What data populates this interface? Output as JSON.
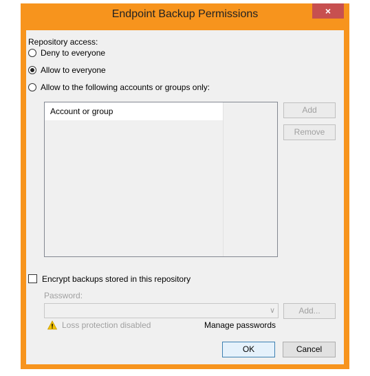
{
  "window": {
    "title": "Endpoint Backup Permissions",
    "close_glyph": "×",
    "frame_color": "#f7941d"
  },
  "access": {
    "label": "Repository access:",
    "options": [
      {
        "label": "Deny to everyone",
        "checked": false
      },
      {
        "label": "Allow to everyone",
        "checked": true
      },
      {
        "label": "Allow to the following accounts or groups only:",
        "checked": false
      }
    ]
  },
  "accounts": {
    "column_header": "Account or group",
    "rows": []
  },
  "buttons": {
    "add": "Add",
    "remove": "Remove",
    "add_password": "Add...",
    "ok": "OK",
    "cancel": "Cancel"
  },
  "encryption": {
    "checkbox_label": "Encrypt backups stored in this repository",
    "checked": false,
    "password_label": "Password:",
    "password_value": "",
    "warning_icon": "warning-icon",
    "loss_protection": "Loss protection disabled",
    "manage_passwords": "Manage passwords"
  }
}
